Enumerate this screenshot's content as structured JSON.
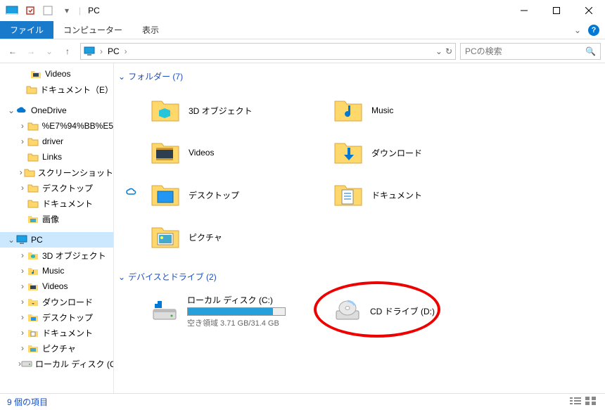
{
  "title": "PC",
  "ribbon": {
    "file": "ファイル",
    "computer": "コンピューター",
    "view": "表示"
  },
  "nav": {
    "crumb_root": "PC",
    "search_placeholder": "PCの検索"
  },
  "sidebar": {
    "items": [
      {
        "label": "Videos",
        "icon": "folder-video",
        "level": 2,
        "caret": ""
      },
      {
        "label": "ドキュメント（E）",
        "icon": "folder",
        "level": 2,
        "caret": ""
      },
      {
        "spacer": true
      },
      {
        "label": "OneDrive",
        "icon": "onedrive",
        "level": 0,
        "caret": "v"
      },
      {
        "label": "%E7%94%BB%E5",
        "icon": "folder",
        "level": 1,
        "caret": ">"
      },
      {
        "label": "driver",
        "icon": "folder",
        "level": 1,
        "caret": ">"
      },
      {
        "label": "Links",
        "icon": "folder",
        "level": 1,
        "caret": ""
      },
      {
        "label": "スクリーンショット",
        "icon": "folder",
        "level": 1,
        "caret": ">"
      },
      {
        "label": "デスクトップ",
        "icon": "folder",
        "level": 1,
        "caret": ">"
      },
      {
        "label": "ドキュメント",
        "icon": "folder",
        "level": 1,
        "caret": ""
      },
      {
        "label": "画像",
        "icon": "folder-pic",
        "level": 1,
        "caret": ""
      },
      {
        "spacer": true
      },
      {
        "label": "PC",
        "icon": "pc",
        "level": 0,
        "caret": "v",
        "selected": true
      },
      {
        "label": "3D オブジェクト",
        "icon": "folder-3d",
        "level": 1,
        "caret": ">"
      },
      {
        "label": "Music",
        "icon": "folder-music",
        "level": 1,
        "caret": ">"
      },
      {
        "label": "Videos",
        "icon": "folder-video",
        "level": 1,
        "caret": ">"
      },
      {
        "label": "ダウンロード",
        "icon": "folder-dl",
        "level": 1,
        "caret": ">"
      },
      {
        "label": "デスクトップ",
        "icon": "folder-desk",
        "level": 1,
        "caret": ">"
      },
      {
        "label": "ドキュメント",
        "icon": "folder-doc",
        "level": 1,
        "caret": ">"
      },
      {
        "label": "ピクチャ",
        "icon": "folder-pic",
        "level": 1,
        "caret": ">"
      },
      {
        "label": "ローカル ディスク (C",
        "icon": "drive",
        "level": 1,
        "caret": ">"
      }
    ]
  },
  "groups": {
    "folders_header": "フォルダー (7)",
    "drives_header": "デバイスとドライブ (2)"
  },
  "folders": [
    {
      "label": "3D オブジェクト",
      "icon": "3d"
    },
    {
      "label": "Music",
      "icon": "music"
    },
    {
      "label": "Videos",
      "icon": "video"
    },
    {
      "label": "ダウンロード",
      "icon": "download"
    },
    {
      "label": "デスクトップ",
      "icon": "desktop"
    },
    {
      "label": "ドキュメント",
      "icon": "document"
    },
    {
      "label": "ピクチャ",
      "icon": "picture"
    }
  ],
  "drives": [
    {
      "label": "ローカル ディスク (C:)",
      "space_text": "空き領域 3.71 GB/31.4 GB",
      "fill_pct": 88
    },
    {
      "label": "CD ドライブ (D:)",
      "circled": true
    }
  ],
  "status": {
    "text": "9 個の項目"
  }
}
